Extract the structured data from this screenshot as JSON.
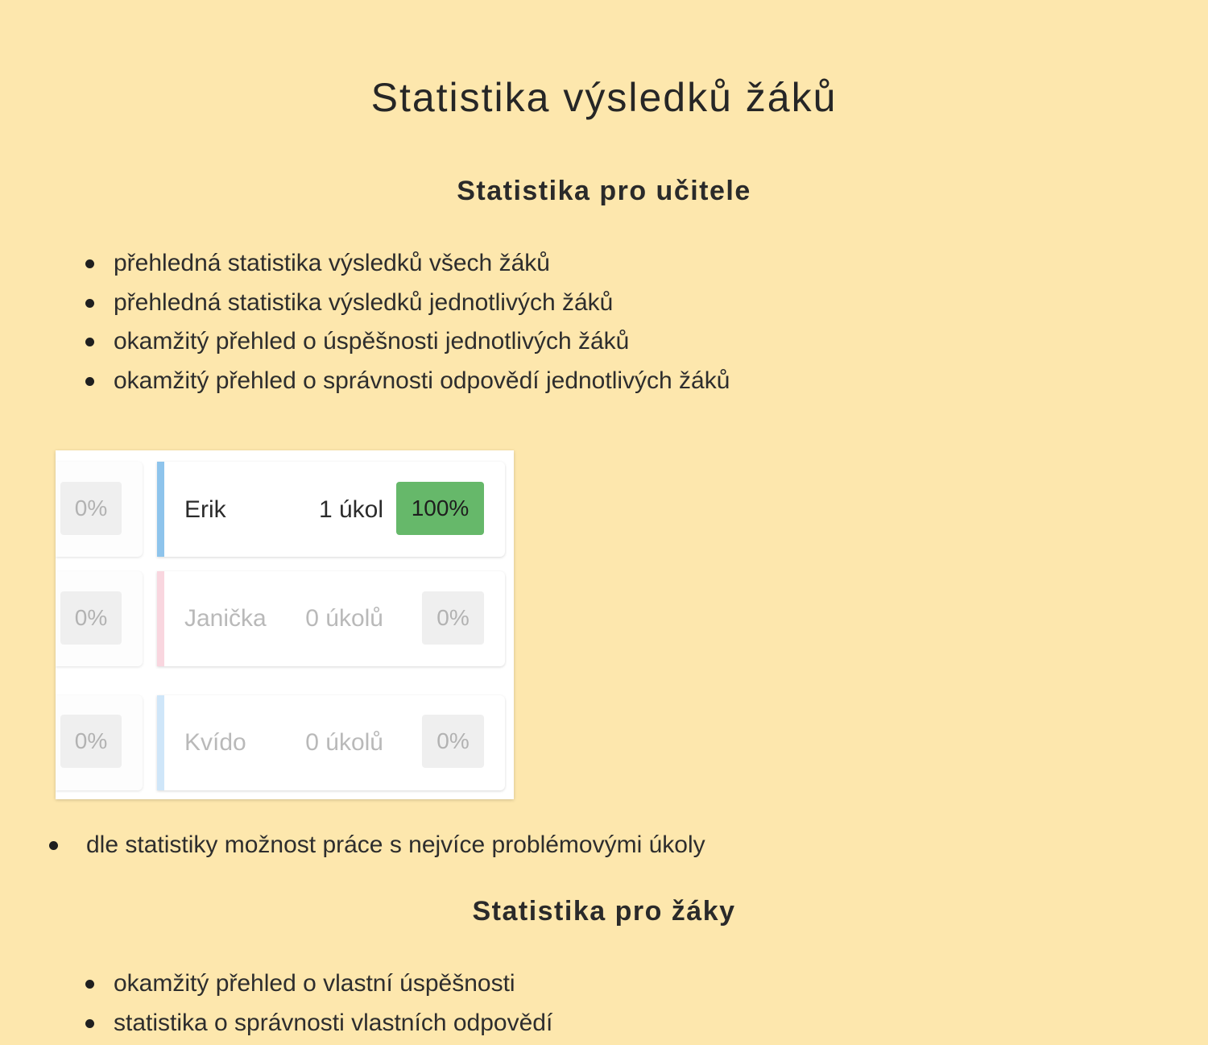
{
  "page": {
    "title": "Statistika výsledků žáků"
  },
  "teacher_section": {
    "heading": "Statistika pro učitele",
    "bullets": [
      "přehledná statistika výsledků všech žáků",
      "přehledná statistika výsledků jednotlivých žáků",
      "okamžitý přehled o úspěšnosti jednotlivých žáků",
      "okamžitý přehled o správnosti odpovědí jednotlivých žáků"
    ],
    "extra_bullet": "dle statistiky možnost práce s nejvíce problémovými úkoly"
  },
  "widget": {
    "previous_column": [
      "0%",
      "0%",
      "0%"
    ],
    "students": [
      {
        "name": "Erik",
        "tasks": "1 úkol",
        "percent": "100%",
        "stripe_color": "#8ec4ec",
        "active": true
      },
      {
        "name": "Janička",
        "tasks": "0 úkolů",
        "percent": "0%",
        "stripe_color": "#f9d6df",
        "active": false
      },
      {
        "name": "Kvído",
        "tasks": "0 úkolů",
        "percent": "0%",
        "stripe_color": "#cfe6f9",
        "active": false
      }
    ]
  },
  "student_section": {
    "heading": "Statistika pro žáky",
    "bullets": [
      "okamžitý přehled o vlastní úspěšnosti",
      "statistika o správnosti vlastních odpovědí"
    ]
  },
  "colors": {
    "background": "#fde7ad",
    "success_badge": "#66b86a",
    "neutral_badge": "#efefef"
  }
}
